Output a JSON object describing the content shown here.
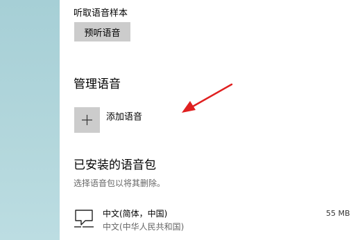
{
  "speech": {
    "sample_label": "听取语音样本",
    "preview_button": "预听语音"
  },
  "manage": {
    "title": "管理语音",
    "add_label": "添加语音",
    "add_icon": "plus-icon",
    "annotation_color": "#e02020"
  },
  "installed": {
    "title": "已安装的语音包",
    "hint": "选择语音包以将其删除。",
    "items": [
      {
        "icon": "speech-bubble-icon",
        "name": "中文(简体，中国)",
        "subtitle": "中文(中华人民共和国)",
        "size": "55 MB"
      }
    ]
  }
}
